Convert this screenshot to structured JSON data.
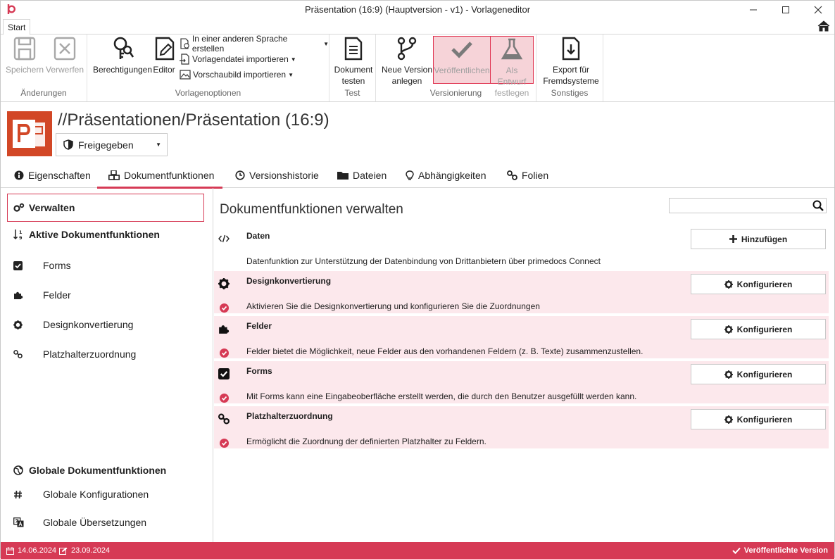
{
  "window": {
    "title": "Präsentation (16:9) (Hauptversion - v1) - Vorlageneditor",
    "ribbon_tab": "Start"
  },
  "ribbon": {
    "aenderungen": {
      "label": "Änderungen",
      "save": "Speichern",
      "discard": "Verwerfen"
    },
    "vorlagenoptionen": {
      "label": "Vorlagenoptionen",
      "permissions": "Berechtigungen",
      "editor": "Editor",
      "create_language": "In einer anderen Sprache erstellen",
      "import_template": "Vorlagendatei importieren",
      "import_preview": "Vorschaubild importieren"
    },
    "test": {
      "label": "Test",
      "test_doc_line1": "Dokument",
      "test_doc_line2": "testen"
    },
    "versionierung": {
      "label": "Versionierung",
      "new_version_line1": "Neue Version",
      "new_version_line2": "anlegen",
      "publish": "Veröffentlichen",
      "draft_line1": "Als Entwurf",
      "draft_line2": "festlegen"
    },
    "sonstiges": {
      "label": "Sonstiges",
      "export_line1": "Export für",
      "export_line2": "Fremdsysteme"
    }
  },
  "document": {
    "path": "//Präsentationen/Präsentation (16:9)",
    "status": "Freigegeben"
  },
  "tabs": [
    {
      "label": "Eigenschaften",
      "icon": "info-icon"
    },
    {
      "label": "Dokumentfunktionen",
      "icon": "cubes-icon",
      "active": true
    },
    {
      "label": "Versionshistorie",
      "icon": "clock-icon"
    },
    {
      "label": "Dateien",
      "icon": "folder-icon"
    },
    {
      "label": "Abhängigkeiten",
      "icon": "lightbulb-icon"
    },
    {
      "label": "Folien",
      "icon": "link-icon"
    }
  ],
  "sidebar": {
    "manage": "Verwalten",
    "active_heading": "Aktive Dokumentfunktionen",
    "active_items": [
      {
        "label": "Forms",
        "icon": "checkbox-icon"
      },
      {
        "label": "Felder",
        "icon": "puzzle-icon"
      },
      {
        "label": "Designkonvertierung",
        "icon": "gear-icon"
      },
      {
        "label": "Platzhalterzuordnung",
        "icon": "link-icon"
      }
    ],
    "global_heading": "Globale Dokumentfunktionen",
    "global_items": [
      {
        "label": "Globale Konfigurationen",
        "icon": "hash-icon"
      },
      {
        "label": "Globale Übersetzungen",
        "icon": "translate-icon"
      }
    ]
  },
  "main": {
    "title": "Dokumentfunktionen verwalten",
    "search_placeholder": "",
    "functions": [
      {
        "title": "Daten",
        "description": "Datenfunktion zur Unterstützung der Datenbindung von Drittanbietern über primedocs Connect",
        "button": "Hinzufügen",
        "active": false,
        "icon": "code-icon"
      },
      {
        "title": "Designkonvertierung",
        "description": "Aktivieren Sie die Designkonvertierung und konfigurieren Sie die Zuordnungen",
        "button": "Konfigurieren",
        "active": true,
        "icon": "gear-icon"
      },
      {
        "title": "Felder",
        "description": "Felder bietet die Möglichkeit, neue Felder aus den vorhandenen Feldern (z. B. Texte) zusammenzustellen.",
        "button": "Konfigurieren",
        "active": true,
        "icon": "puzzle-icon"
      },
      {
        "title": "Forms",
        "description": "Mit Forms kann eine Eingabeoberfläche erstellt werden, die durch den Benutzer ausgefüllt werden kann.",
        "button": "Konfigurieren",
        "active": true,
        "icon": "checkbox-icon"
      },
      {
        "title": "Platzhalterzuordnung",
        "description": "Ermöglicht die Zuordnung der definierten Platzhalter zu Feldern.",
        "button": "Konfigurieren",
        "active": true,
        "icon": "link-icon"
      }
    ]
  },
  "statusbar": {
    "created": "14.06.2024",
    "modified": "23.09.2024",
    "state": "Veröffentlichte Version"
  },
  "colors": {
    "accent": "#d63a55",
    "row_highlight": "#fce8ec",
    "ppt": "#d24726"
  }
}
